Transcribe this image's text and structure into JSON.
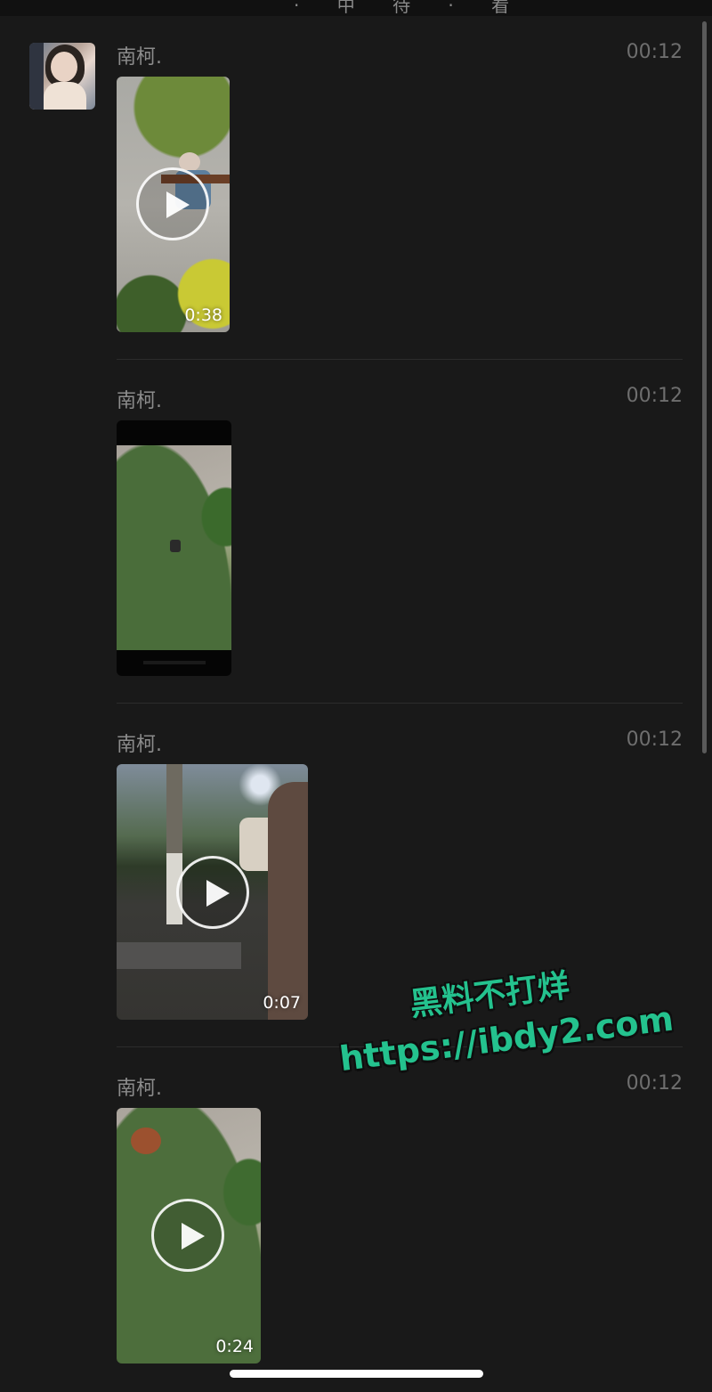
{
  "header": {
    "title_glyphs": "· 中 待 · 看"
  },
  "messages": [
    {
      "sender": "南柯.",
      "time": "00:12",
      "media": "video",
      "duration": "0:38",
      "has_play_icon": true
    },
    {
      "sender": "南柯.",
      "time": "00:12",
      "media": "image",
      "duration": "",
      "has_play_icon": false
    },
    {
      "sender": "南柯.",
      "time": "00:12",
      "media": "video",
      "duration": "0:07",
      "has_play_icon": true
    },
    {
      "sender": "南柯.",
      "time": "00:12",
      "media": "video",
      "duration": "0:24",
      "has_play_icon": true
    }
  ],
  "watermark": {
    "line1": "黑料不打烊",
    "line2": "https://ibdy2.com"
  },
  "colors": {
    "background": "#191919",
    "sender_text": "#8c8c8c",
    "time_text": "#6e6e6e",
    "watermark": "#24c28e"
  },
  "icons": [
    "play-icon",
    "avatar-image"
  ]
}
